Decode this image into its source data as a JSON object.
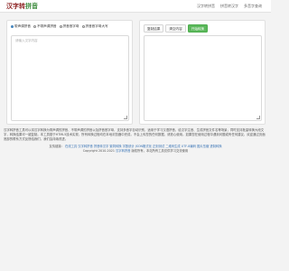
{
  "header": {
    "logo_part1": "汉字转",
    "logo_part2": "拼音",
    "nav": [
      "汉字转拼音",
      "拼音转汉字",
      "多音字查询"
    ]
  },
  "converter": {
    "options": [
      {
        "label": "带声调拼音",
        "checked": true
      },
      {
        "label": "不带声调拼音",
        "checked": false
      },
      {
        "label": "拼音首字母",
        "checked": false
      },
      {
        "label": "拼音首字母大写",
        "checked": false
      }
    ],
    "input_placeholder": "请输入汉字内容",
    "tabs": [
      {
        "label": "复制结果",
        "active": false
      },
      {
        "label": "清空内容",
        "active": false
      },
      {
        "label": "开始转换",
        "active": true
      }
    ],
    "output_value": ""
  },
  "description": "汉字转拼音工具可以将汉字转换为带声调的拼音、不带声调的拼音以及拼音首字母，支持多音字自动识别，适用于学习汉语拼音、给汉字注音、生成拼音文件名等场景，同时支持批量转换大段文字，转换结果可一键复制。本工具基于HTML5技术实现，所有转换过程均在本地浏览器中完成，不会上传您的任何数据，请放心使用。如果您在使用过程中遇到问题或有任何建议，欢迎通过页面底部的联系方式反馈给我们，我们会持续改进。",
  "footer": {
    "prefix": "友情链接：",
    "links": [
      "在线工具",
      "汉字转拼音",
      "拼音转汉字",
      "繁简转换",
      "字数统计",
      "JSON格式化",
      "正则测试",
      "二维码生成",
      "UTF-8编码",
      "图片压缩",
      "进制转换"
    ],
    "copyright": "Copyright 2010-2021",
    "copyright_link": "汉字转拼音",
    "copyright_suffix": "版权所有，本站所有工具仅供学习交流使用"
  },
  "colors": {
    "accent_green": "#5cb85c",
    "link_blue": "#3873b5",
    "logo_red": "#8a1c1c",
    "logo_green": "#3a8a3a"
  }
}
